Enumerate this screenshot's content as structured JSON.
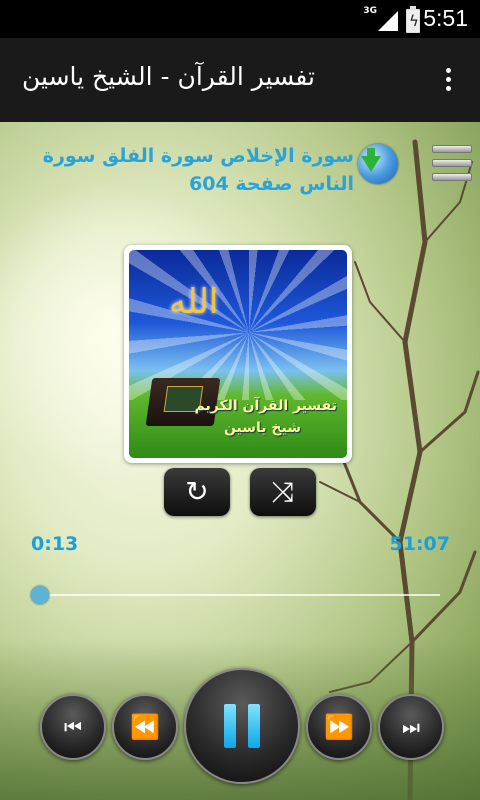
{
  "status_bar": {
    "network": "3G",
    "clock": "5:51"
  },
  "action_bar": {
    "title": "تفسير القرآن - الشيخ ياسين",
    "overflow_icon": "more-vertical-icon"
  },
  "now_playing": {
    "title": "سورة الإخلاص سورة الفلق سورة الناس صفحة 604"
  },
  "cover": {
    "caption_line1": "تفسير القرآن الكريم",
    "caption_line2": "شيخ ياسين",
    "calligraphy": "الله"
  },
  "playback": {
    "current_time": "0:13",
    "total_time": "51:07",
    "progress_fraction": 0.004,
    "state": "playing"
  },
  "controls": {
    "repeat_icon": "repeat-icon",
    "shuffle_icon": "shuffle-icon",
    "prev_icon": "skip-previous-icon",
    "rewind_icon": "rewind-icon",
    "pause_icon": "pause-icon",
    "forward_icon": "fast-forward-icon",
    "next_icon": "skip-next-icon"
  },
  "colors": {
    "accent": "#2aa3d8",
    "actionbar": "#1a1a1a"
  }
}
